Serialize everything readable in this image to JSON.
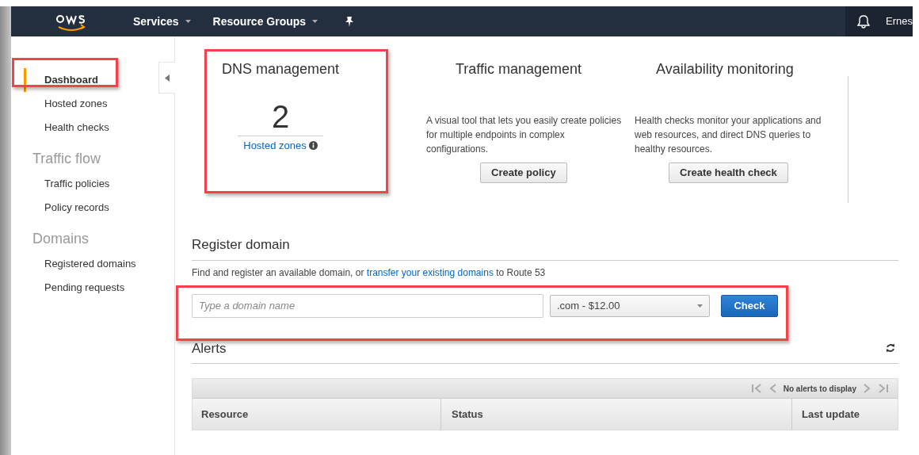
{
  "topbar": {
    "services": "Services",
    "resource_groups": "Resource Groups",
    "user": "Ernes"
  },
  "sidebar": {
    "items": [
      {
        "kind": "link",
        "label": "Dashboard",
        "selected": true
      },
      {
        "kind": "link",
        "label": "Hosted zones",
        "selected": false
      },
      {
        "kind": "link",
        "label": "Health checks",
        "selected": false
      },
      {
        "kind": "heading",
        "label": "Traffic flow"
      },
      {
        "kind": "link",
        "label": "Traffic policies",
        "selected": false
      },
      {
        "kind": "link",
        "label": "Policy records",
        "selected": false
      },
      {
        "kind": "heading",
        "label": "Domains"
      },
      {
        "kind": "link",
        "label": "Registered domains",
        "selected": false
      },
      {
        "kind": "link",
        "label": "Pending requests",
        "selected": false
      }
    ]
  },
  "dns_management": {
    "title": "DNS management",
    "count": "2",
    "link": "Hosted zones"
  },
  "traffic_management": {
    "title": "Traffic management",
    "description": "A visual tool that lets you easily create policies for multiple endpoints in complex configurations.",
    "button": "Create policy"
  },
  "availability_monitoring": {
    "title": "Availability monitoring",
    "description": "Health checks monitor your applications and web resources, and direct DNS queries to healthy resources.",
    "button": "Create health check"
  },
  "register_domain": {
    "title": "Register domain",
    "intro_before": "Find and register an available domain, or",
    "intro_link": "transfer your existing domains",
    "intro_after": "to Route 53",
    "placeholder": "Type a domain name",
    "tld": ".com - $12.00",
    "button": "Check"
  },
  "alerts": {
    "title": "Alerts",
    "pager_text": "No alerts to display",
    "columns": [
      "Resource",
      "Status",
      "Last update"
    ]
  }
}
